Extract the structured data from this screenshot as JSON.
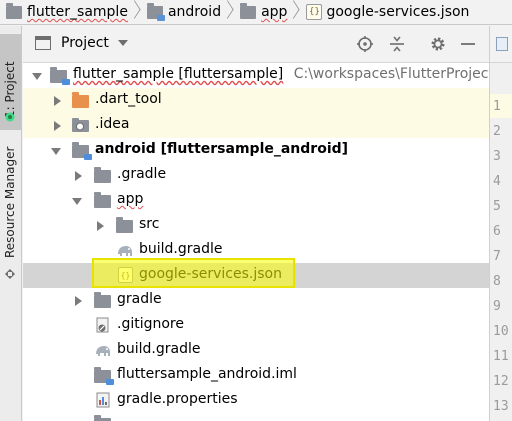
{
  "breadcrumb": {
    "items": [
      {
        "label": "flutter_sample",
        "icon": "folder-icon"
      },
      {
        "label": "android",
        "icon": "module-folder-icon"
      },
      {
        "label": "app",
        "icon": "folder-icon"
      },
      {
        "label": "google-services.json",
        "icon": "json-file-icon"
      }
    ]
  },
  "side_stripe": {
    "project_tab": "1: Project",
    "resource_tab": "Resource Manager"
  },
  "panel": {
    "title": "Project",
    "toolbar": [
      "locate-icon",
      "collapse-all-icon",
      "gear-icon",
      "minimize-icon"
    ]
  },
  "tree": {
    "rows": [
      {
        "label": "flutter_sample [fluttersample]",
        "path": "C:\\workspaces\\FlutterProjects\\f",
        "icon": "module-folder-icon"
      },
      {
        "label": ".dart_tool",
        "icon": "folder-orange-icon"
      },
      {
        "label": ".idea",
        "icon": "idea-folder-icon"
      },
      {
        "label": "android [fluttersample_android]",
        "icon": "module-folder-icon"
      },
      {
        "label": ".gradle",
        "icon": "folder-icon"
      },
      {
        "label": "app",
        "icon": "folder-icon"
      },
      {
        "label": "src",
        "icon": "folder-icon"
      },
      {
        "label": "build.gradle",
        "icon": "gradle-elephant-icon"
      },
      {
        "label": "google-services.json",
        "icon": "json-file-icon"
      },
      {
        "label": "gradle",
        "icon": "folder-icon"
      },
      {
        "label": ".gitignore",
        "icon": "gitignore-icon"
      },
      {
        "label": "build.gradle",
        "icon": "gradle-elephant-icon"
      },
      {
        "label": "fluttersample_android.iml",
        "icon": "module-file-icon"
      },
      {
        "label": "gradle.properties",
        "icon": "properties-file-icon"
      }
    ]
  },
  "gutter": {
    "line_numbers": [
      "1",
      "2",
      "3",
      "4",
      "5",
      "6",
      "7",
      "8",
      "9",
      "10",
      "11",
      "12",
      "13"
    ]
  },
  "colors": {
    "highlight": "#ffff00",
    "selected_row": "#d4d4d4",
    "modified_row": "#fdfbe4",
    "folder_orange": "#e8914d",
    "folder_grey": "#8b9099"
  }
}
